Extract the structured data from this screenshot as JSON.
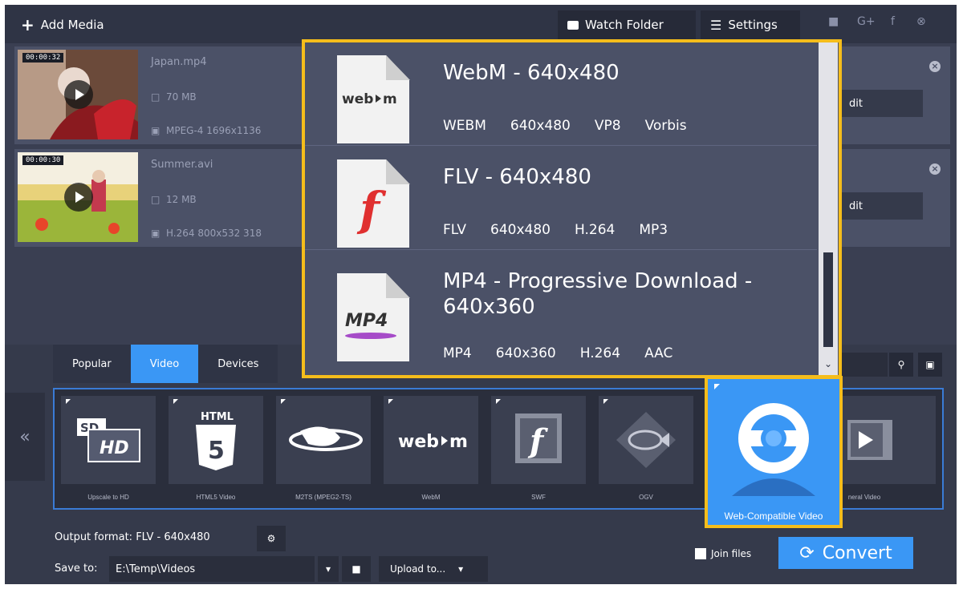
{
  "toolbar": {
    "add_media": "Add Media",
    "watch_folder": "Watch Folder",
    "settings": "Settings"
  },
  "social": [
    "youtube-icon",
    "google-plus-icon",
    "facebook-icon",
    "vk-icon"
  ],
  "files": [
    {
      "timestamp": "00:00:32",
      "name": "Japan.mp4",
      "size": "70 MB",
      "codec": "MPEG-4 1696x1136",
      "edit": "dit"
    },
    {
      "timestamp": "00:00:30",
      "name": "Summer.avi",
      "size": "12 MB",
      "codec": "H.264 800x532 318",
      "edit": "dit"
    }
  ],
  "tabs": [
    "Popular",
    "Video",
    "Devices"
  ],
  "active_tab": "Video",
  "presets": [
    {
      "label": "Upscale to HD",
      "icon": "sd-hd-icon"
    },
    {
      "label": "HTML5 Video",
      "icon": "html5-icon"
    },
    {
      "label": "M2TS (MPEG2-TS)",
      "icon": "bluray-icon"
    },
    {
      "label": "WebM",
      "icon": "webm-icon"
    },
    {
      "label": "SWF",
      "icon": "flash-icon"
    },
    {
      "label": "OGV",
      "icon": "ogv-fish-icon"
    }
  ],
  "web_compatible": {
    "label": "Web-Compatible Video"
  },
  "next_preset": {
    "label": "neral Video"
  },
  "popup": {
    "items": [
      {
        "title": "WebM - 640x480",
        "doc_label": "web▸m",
        "specs": [
          "WEBM",
          "640x480",
          "VP8",
          "Vorbis"
        ]
      },
      {
        "title": "FLV - 640x480",
        "doc_label": "ƒ",
        "specs": [
          "FLV",
          "640x480",
          "H.264",
          "MP3"
        ]
      },
      {
        "title": "MP4 - Progressive Download - 640x360",
        "doc_label": "MP4",
        "specs": [
          "MP4",
          "640x360",
          "H.264",
          "AAC"
        ]
      }
    ]
  },
  "output": {
    "label": "Output format:",
    "value": "FLV - 640x480"
  },
  "save": {
    "label": "Save to:",
    "path": "E:\\Temp\\Videos",
    "upload": "Upload to..."
  },
  "join_files": "Join files",
  "convert": "Convert",
  "colors": {
    "accent": "#3a97f5",
    "highlight": "#f5bd1b",
    "panel": "#3a3f52"
  }
}
